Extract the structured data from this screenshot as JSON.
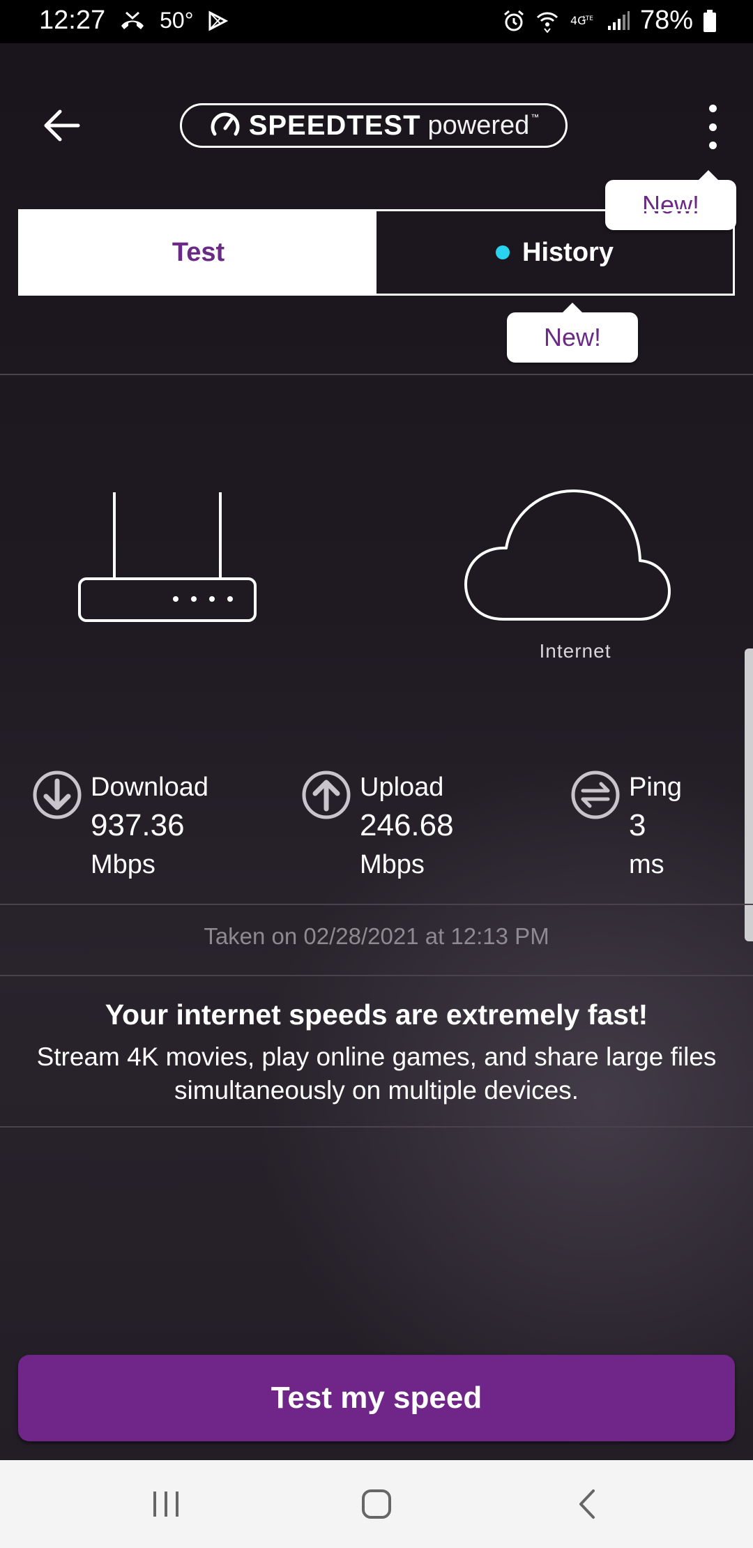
{
  "status_bar": {
    "time": "12:27",
    "temperature": "50°",
    "battery": "78%",
    "icons": [
      "missed-call-icon",
      "play-store-icon",
      "alarm-icon",
      "wifi-icon",
      "volte-icon",
      "signal-icon",
      "battery-icon"
    ]
  },
  "header": {
    "logo_brand": "SPEEDTEST",
    "logo_suffix": "powered",
    "logo_tm": "™",
    "menu_tooltip": "New!"
  },
  "tabs": {
    "test_label": "Test",
    "history_label": "History",
    "active": "Test",
    "history_tooltip": "New!",
    "history_dot_color": "#29d3f0"
  },
  "illustration": {
    "internet_label": "Internet"
  },
  "metrics": {
    "download": {
      "label": "Download",
      "value": "937.36",
      "unit": "Mbps"
    },
    "upload": {
      "label": "Upload",
      "value": "246.68",
      "unit": "Mbps"
    },
    "ping": {
      "label": "Ping",
      "value": "3",
      "unit": "ms"
    }
  },
  "taken_on": "Taken on 02/28/2021 at 12:13 PM",
  "verdict": {
    "title": "Your internet speeds are extremely fast!",
    "body": "Stream 4K movies, play online games, and share large files simultaneously on multiple devices."
  },
  "cta": {
    "label": "Test my speed"
  },
  "colors": {
    "accent": "#6f2688",
    "tab_active_text": "#6b2a86",
    "background": "#1c161d"
  }
}
